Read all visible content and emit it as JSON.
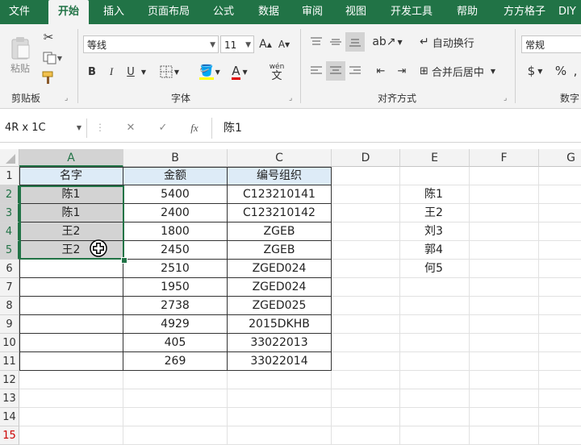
{
  "tabs": [
    "文件",
    "开始",
    "插入",
    "页面布局",
    "公式",
    "数据",
    "审阅",
    "视图",
    "开发工具",
    "帮助",
    "方方格子",
    "DIY"
  ],
  "active_tab": "开始",
  "clipboard": {
    "paste": "粘贴",
    "group_label": "剪贴板"
  },
  "font": {
    "name": "等线",
    "size": "11",
    "bold": "B",
    "italic": "I",
    "underline": "U",
    "grow": "A",
    "shrink": "A",
    "color_letter": "A",
    "phonetic_top": "wén",
    "phonetic_char": "文",
    "group_label": "字体"
  },
  "alignment": {
    "wrap_text": "自动换行",
    "merge_center": "合并后居中",
    "group_label": "对齐方式"
  },
  "number": {
    "format": "常规",
    "currency": "$",
    "percent": "%",
    "group_label": "数字"
  },
  "formula_bar": {
    "name_box": "4R x 1C",
    "cancel": "✕",
    "enter": "✓",
    "fx": "fx",
    "content": "陈1"
  },
  "columns": [
    "A",
    "B",
    "C",
    "D",
    "E",
    "F",
    "G"
  ],
  "rows": [
    "1",
    "2",
    "3",
    "4",
    "5",
    "6",
    "7",
    "8",
    "9",
    "10",
    "11",
    "12",
    "13",
    "14",
    "15"
  ],
  "table": {
    "headers": [
      "名字",
      "金额",
      "编号组织"
    ],
    "rows": [
      [
        "陈1",
        "5400",
        "C123210141"
      ],
      [
        "陈1",
        "2400",
        "C123210142"
      ],
      [
        "王2",
        "1800",
        "ZGEB"
      ],
      [
        "王2",
        "2450",
        "ZGEB"
      ],
      [
        "",
        "2510",
        "ZGED024"
      ],
      [
        "",
        "1950",
        "ZGED024"
      ],
      [
        "",
        "2738",
        "ZGED025"
      ],
      [
        "",
        "4929",
        "2015DKHB"
      ],
      [
        "",
        "405",
        "33022013"
      ],
      [
        "",
        "269",
        "33022014"
      ]
    ]
  },
  "column_e": [
    "陈1",
    "王2",
    "刘3",
    "郭4",
    "何5"
  ],
  "colors": {
    "accent": "#217346",
    "header_fill": "#ddebf7",
    "selection_fill": "#d3d3d3",
    "font_color_bar": "#e00000"
  }
}
